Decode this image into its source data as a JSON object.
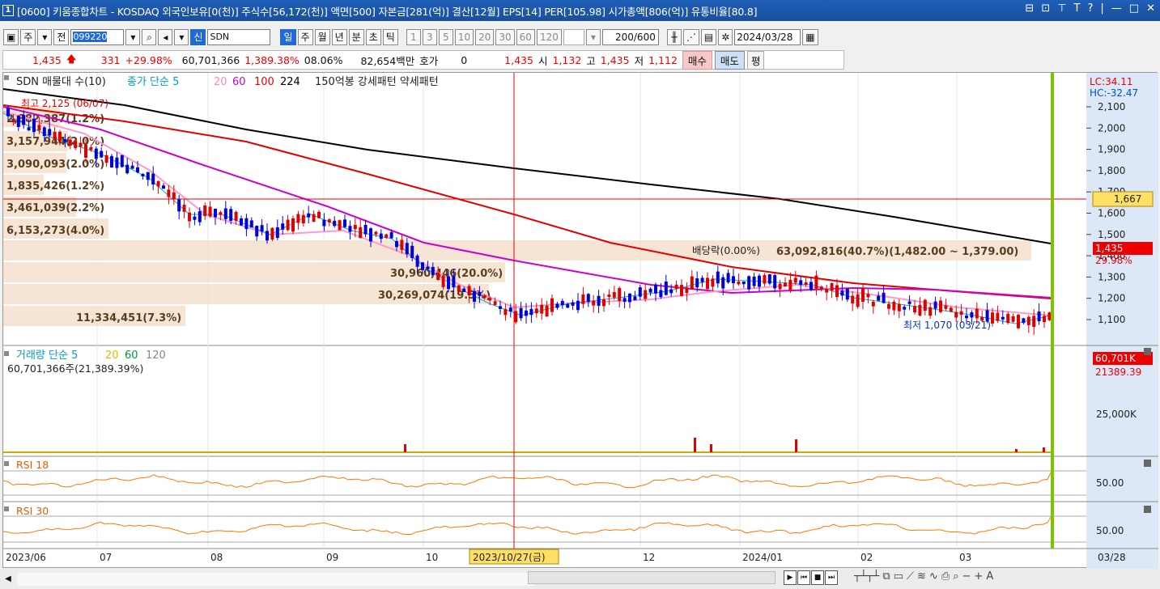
{
  "titlebar": {
    "number": "1",
    "title": "[0600] 키움종합차트 - KOSDAQ 외국인보유[0(천)] 주식수[56,172(천)] 액면[500] 자본금[281(억)] 결산[12월] EPS[14] PER[105.98] 시가총액[806(억)] 유통비율[80.8]",
    "controls": [
      "⊟",
      "⊡",
      "⊤",
      "T",
      "?",
      "|",
      "—",
      "□",
      "✕"
    ]
  },
  "toolbar": {
    "type_label": "주",
    "prev_label": "전",
    "code": "099220",
    "credit_label": "신",
    "name": "SDN",
    "periods": [
      "일",
      "주",
      "월",
      "년",
      "분",
      "초",
      "틱"
    ],
    "intervals": [
      "1",
      "3",
      "5",
      "10",
      "20",
      "30",
      "60",
      "120"
    ],
    "count": "200",
    "total": "/600",
    "date": "2024/03/28"
  },
  "quote": {
    "price": "1,435",
    "change": "331",
    "change_pct": "+29.98%",
    "volume": "60,701,366",
    "volume_pct": "1,389.38%",
    "turnover": "08.06%",
    "amount": "82,654백만",
    "hoga_label": "호가",
    "hoga_value": "0",
    "hoga_price": "1,435",
    "open_label": "시",
    "open": "1,132",
    "high_label": "고",
    "high": "1,435",
    "low_label": "저",
    "low": "1,112",
    "buy_label": "매수",
    "sell_label": "매도",
    "avg_label": "평"
  },
  "legend": {
    "title": "SDN 매물대 수(10)",
    "ma_label": "종가 단순 5",
    "ma20": "20",
    "ma60": "60",
    "ma100": "100",
    "ma224": "224",
    "pattern": "150억봉 강세패턴  약세패턴",
    "high_note": "최고 2,125 (06/07)",
    "low_note": "최저 1,070 (03/21)",
    "dividend_note": "배당락(0.00%)",
    "lc": "LC:34.11",
    "hc": "HC:-32.47",
    "price_tag": "1,435",
    "pct_tag": "29.98%",
    "line_tag": "1,667"
  },
  "volume_profile": [
    "2,882,387(1.2%)",
    "3,157,944(2.0%)",
    "3,090,093(2.0%)",
    "1,835,426(1.2%)",
    "3,461,039(2.2%)",
    "6,153,273(4.0%)",
    "63,092,816(40.7%)(1,482.00 ~ 1,379.00)",
    "30,960,446(20.0%)",
    "30,269,074(19.5%)",
    "11,334,451(7.3%)"
  ],
  "volume_panel": {
    "title": "거래량 단순 5",
    "ma20": "20",
    "ma60": "60",
    "ma120": "120",
    "summary": "60,701,366주(21,389.39%)",
    "tag1": "60,701K",
    "tag2": "21389.39",
    "axis": "25,000K"
  },
  "rsi": [
    {
      "title": "RSI 18",
      "axis": "50.00"
    },
    {
      "title": "RSI 30",
      "axis": "50.00"
    }
  ],
  "y_axis_ticks": [
    "2,100",
    "2,000",
    "1,900",
    "1,800",
    "1,700",
    "1,600",
    "1,500",
    "1,400",
    "1,300",
    "1,200",
    "1,100"
  ],
  "x_axis": {
    "labels": [
      "2023/06",
      "07",
      "08",
      "09",
      "10",
      "12",
      "2024/01",
      "02",
      "03"
    ],
    "cursor_date": "2023/10/27(금)",
    "last_date": "03/28"
  },
  "colors": {
    "up": "#e00000",
    "down": "#0000dd",
    "ma5": "#00b0d0",
    "ma20": "#ff99cc",
    "ma60": "#cc00cc",
    "ma100": "#e00000",
    "ma224": "#000000",
    "profile": "#f5e1cc"
  },
  "nav_buttons": [
    "▶",
    "⏮",
    "■",
    "⏭"
  ],
  "tool_icons": [
    "zoom-out-icon",
    "zoom-in-icon",
    "font-icon"
  ]
}
